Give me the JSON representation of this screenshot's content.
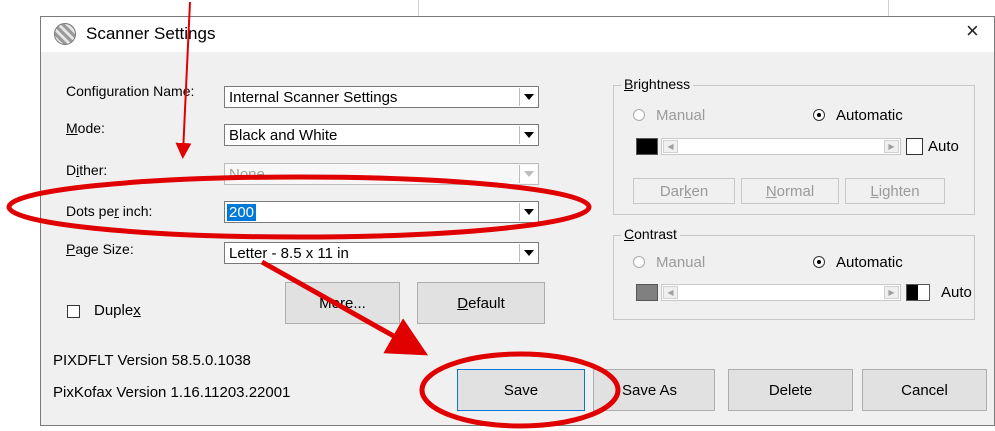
{
  "window": {
    "title": "Scanner Settings",
    "close_glyph": "×"
  },
  "form": {
    "configuration_name": {
      "label": "Configuration Name:",
      "value": "Internal Scanner Settings"
    },
    "mode": {
      "label_prefix": "",
      "label_underlined": "M",
      "label_rest": "ode:",
      "value": "Black and White"
    },
    "dither": {
      "label_prefix": "D",
      "label_underlined": "i",
      "label_rest": "ther:",
      "value": "None"
    },
    "dpi": {
      "label_prefix": "Dots pe",
      "label_underlined": "r",
      "label_rest": " inch:",
      "value": "200"
    },
    "page_size": {
      "label_prefix": "",
      "label_underlined": "P",
      "label_rest": "age Size:",
      "value": "Letter - 8.5 x 11 in"
    },
    "duplex": {
      "label_prefix": "Duple",
      "label_underlined": "x",
      "label_rest": "",
      "checked": false
    }
  },
  "buttons": {
    "more": "More...",
    "default_prefix": "",
    "default_underlined": "D",
    "default_rest": "efault",
    "save": "Save",
    "save_as": "Save As",
    "delete": "Delete",
    "cancel": "Cancel"
  },
  "brightness": {
    "title_underlined": "B",
    "title_rest": "rightness",
    "manual": "Manual",
    "automatic": "Automatic",
    "auto": "Auto",
    "darken_prefix": "Dar",
    "darken_underlined": "k",
    "darken_rest": "en",
    "normal_prefix": "",
    "normal_underlined": "N",
    "normal_rest": "ormal",
    "lighten_prefix": "",
    "lighten_underlined": "L",
    "lighten_rest": "ighten",
    "swatch_color": "#000000"
  },
  "contrast": {
    "title_underlined": "C",
    "title_rest": "ontrast",
    "manual": "Manual",
    "automatic": "Automatic",
    "auto": "Auto",
    "swatch_color": "#808080"
  },
  "versions": {
    "pixdflt": "PIXDFLT Version 58.5.0.1038",
    "pixkofax": "PixKofax Version 1.16.11203.22001"
  },
  "annotation": {
    "color": "#e10000"
  }
}
